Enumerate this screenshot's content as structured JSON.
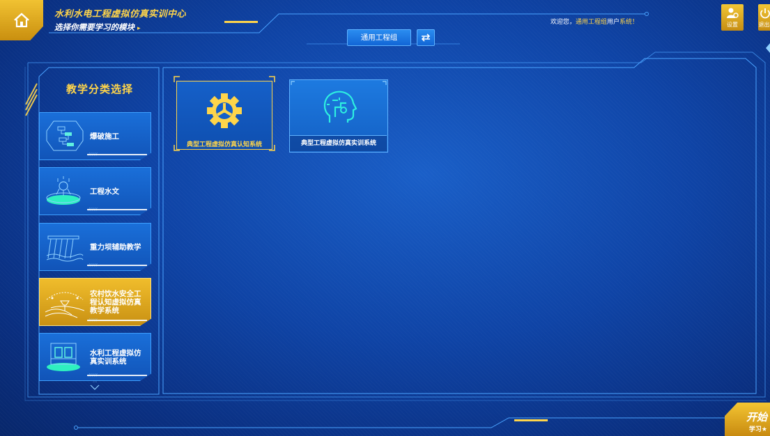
{
  "header": {
    "title": "水利水电工程虚拟仿真实训中心",
    "subtitle": "选择你需要学习的模块",
    "subtitle_arrow": "▸",
    "welcome_prefix": "欢迎您，",
    "welcome_group": "通用工程组",
    "welcome_mid": "用户",
    "welcome_suffix": "系统！",
    "group_tab": "通用工程组",
    "settings_label": "设置",
    "logout_label": "退出"
  },
  "sidebar": {
    "title": "教学分类选择",
    "items": [
      {
        "label": "爆破施工",
        "icon": "flowchart-icon",
        "active": false
      },
      {
        "label": "工程水文",
        "icon": "hydrology-icon",
        "active": false
      },
      {
        "label": "重力坝辅助教学",
        "icon": "dam-icon",
        "active": false
      },
      {
        "label": "农村饮水安全工程认知虚拟仿真教学系统",
        "icon": "irrigation-icon",
        "active": true
      },
      {
        "label": "水利工程虚拟仿真实训系统",
        "icon": "sluice-icon",
        "active": false
      }
    ]
  },
  "modules": [
    {
      "label": "典型工程虚拟仿真认知系统",
      "icon": "gear-icon",
      "selected": true
    },
    {
      "label": "典型工程虚拟仿真实训系统",
      "icon": "head-circuit-icon",
      "selected": false
    }
  ],
  "start_button": {
    "big": "开始",
    "small": "学习★"
  },
  "colors": {
    "accent": "#ffd54a",
    "primary": "#1a6fd9",
    "background": "#0f44a6"
  }
}
